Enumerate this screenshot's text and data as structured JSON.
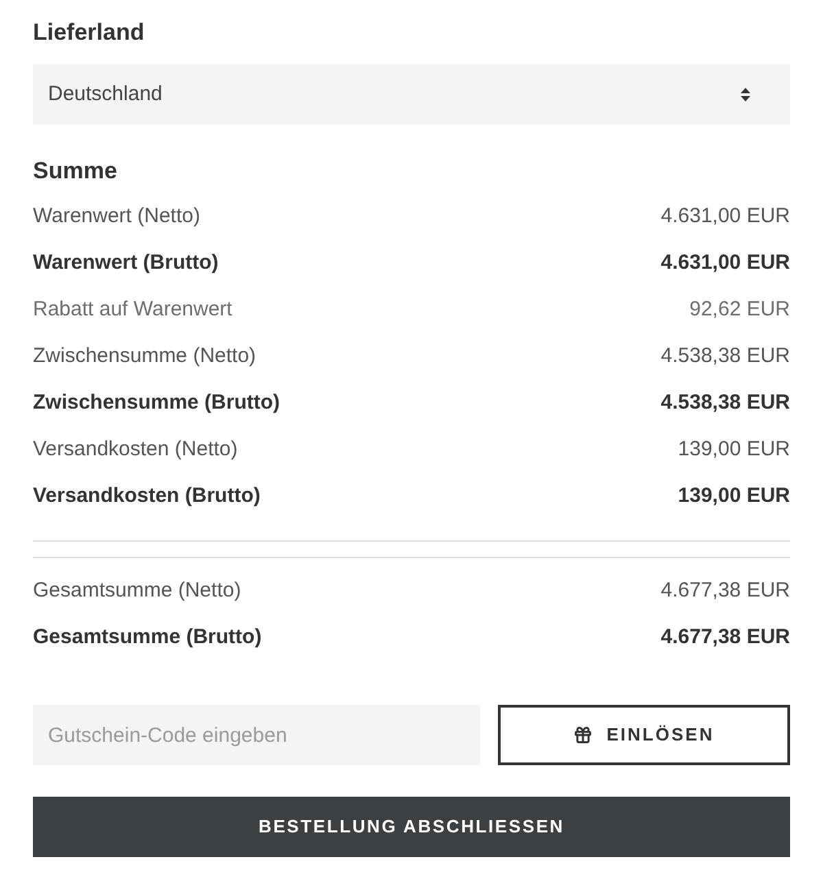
{
  "delivery_country": {
    "label": "Lieferland",
    "value": "Deutschland"
  },
  "summary": {
    "title": "Summe",
    "rows": [
      {
        "label": "Warenwert (Netto)",
        "amount": "4.631,00 EUR",
        "kind": "net"
      },
      {
        "label": "Warenwert (Brutto)",
        "amount": "4.631,00 EUR",
        "kind": "gross"
      },
      {
        "label": "Rabatt auf Warenwert",
        "amount": "92,62 EUR",
        "kind": "discount"
      },
      {
        "label": "Zwischensumme (Netto)",
        "amount": "4.538,38 EUR",
        "kind": "net"
      },
      {
        "label": "Zwischensumme (Brutto)",
        "amount": "4.538,38 EUR",
        "kind": "gross"
      },
      {
        "label": "Versandkosten (Netto)",
        "amount": "139,00 EUR",
        "kind": "net"
      },
      {
        "label": "Versandkosten (Brutto)",
        "amount": "139,00 EUR",
        "kind": "gross"
      }
    ],
    "totals": [
      {
        "label": "Gesamtsumme (Netto)",
        "amount": "4.677,38 EUR",
        "kind": "net"
      },
      {
        "label": "Gesamtsumme (Brutto)",
        "amount": "4.677,38 EUR",
        "kind": "gross"
      }
    ]
  },
  "voucher": {
    "placeholder": "Gutschein-Code eingeben",
    "button": "EINLÖSEN"
  },
  "checkout_button": "BESTELLUNG ABSCHLIESSEN"
}
